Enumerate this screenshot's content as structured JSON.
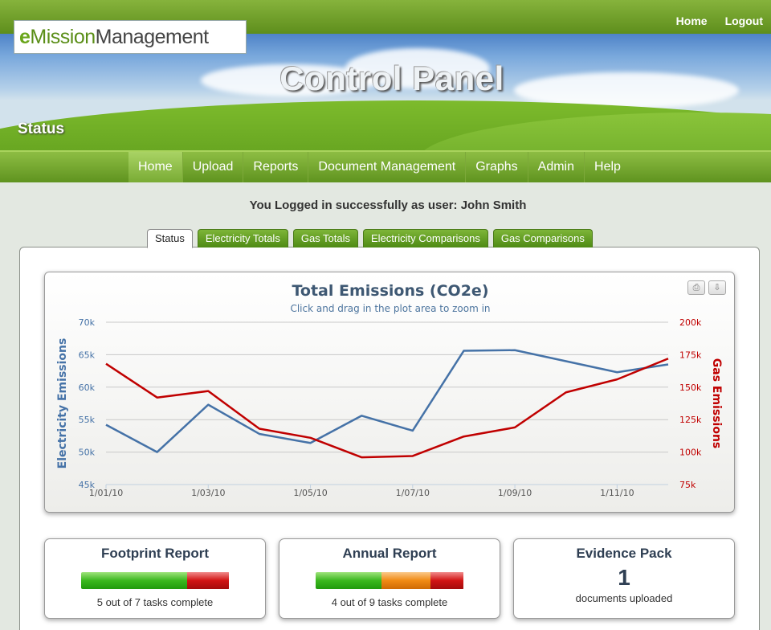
{
  "header": {
    "logo": {
      "e": "e",
      "mission": "Mission",
      "management": "Management"
    },
    "title": "Control Panel",
    "subtitle": "Status",
    "links": [
      "Home",
      "Logout"
    ]
  },
  "nav": {
    "items": [
      "Home",
      "Upload",
      "Reports",
      "Document Management",
      "Graphs",
      "Admin",
      "Help"
    ],
    "active": "Home"
  },
  "welcome": "You Logged in successfully as user: John Smith",
  "tabs": {
    "items": [
      "Status",
      "Electricity Totals",
      "Gas Totals",
      "Electricity Comparisons",
      "Gas Comparisons"
    ],
    "active": "Status"
  },
  "colors": {
    "electricity": "#4572a7",
    "gas": "#c00000",
    "brand_green": "#5f931f"
  },
  "chart_data": {
    "type": "line",
    "title": "Total Emissions (CO2e)",
    "subtitle": "Click and drag in the plot area to zoom in",
    "x": [
      "1/01/10",
      "1/02/10",
      "1/03/10",
      "1/04/10",
      "1/05/10",
      "1/06/10",
      "1/07/10",
      "1/08/10",
      "1/09/10",
      "1/10/10",
      "1/11/10",
      "1/12/10"
    ],
    "x_tick_labels": [
      "1/01/10",
      "1/03/10",
      "1/05/10",
      "1/07/10",
      "1/09/10",
      "1/11/10"
    ],
    "ylabel_left": "Electricity Emissions",
    "ylabel_right": "Gas Emissions",
    "ylim_left": [
      45000,
      70000
    ],
    "ylim_right": [
      75000,
      200000
    ],
    "y_ticks_left": [
      "45k",
      "50k",
      "55k",
      "60k",
      "65k",
      "70k"
    ],
    "y_ticks_right": [
      "75k",
      "100k",
      "125k",
      "150k",
      "175k",
      "200k"
    ],
    "grid": true,
    "series": [
      {
        "name": "Electricity Emissions",
        "axis": "left",
        "color": "#4572a7",
        "values": [
          54200,
          50000,
          57300,
          52800,
          51400,
          55600,
          53300,
          65600,
          65700,
          64000,
          62300,
          63500
        ]
      },
      {
        "name": "Gas Emissions",
        "axis": "right",
        "color": "#c00000",
        "values": [
          168000,
          142000,
          147000,
          118000,
          111000,
          96000,
          97000,
          112000,
          119000,
          146000,
          156000,
          172000
        ]
      }
    ]
  },
  "cards": {
    "footprint": {
      "title": "Footprint Report",
      "caption": "5 out of 7 tasks complete",
      "completed": 5,
      "total": 7
    },
    "annual": {
      "title": "Annual Report",
      "caption": "4 out of 9 tasks complete",
      "completed": 4,
      "in_progress": 3,
      "total": 9
    },
    "evidence": {
      "title": "Evidence Pack",
      "count": "1",
      "caption": "documents uploaded"
    }
  }
}
